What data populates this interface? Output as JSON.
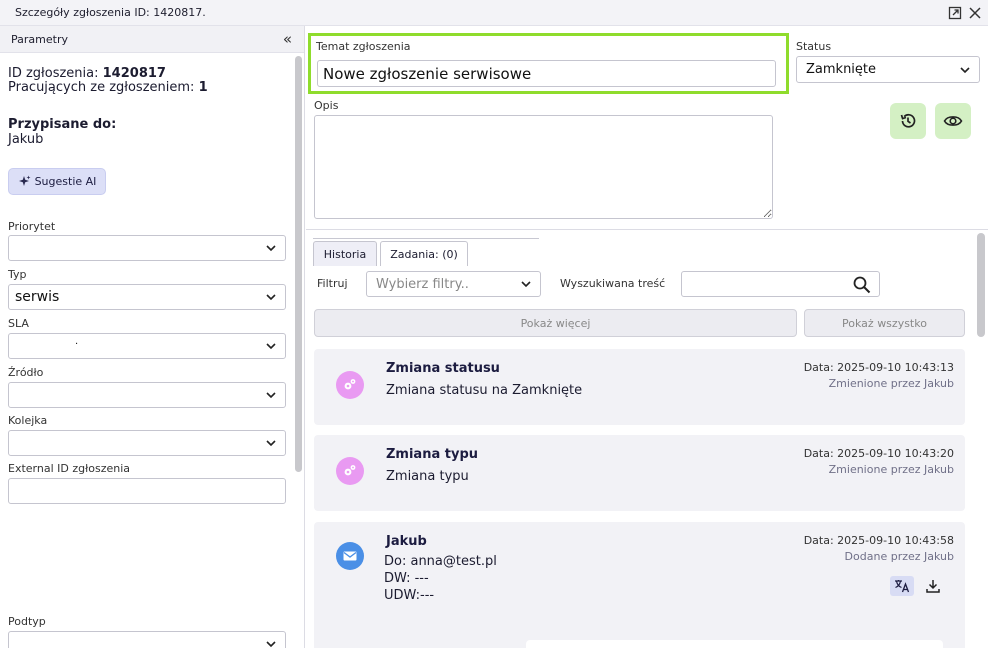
{
  "window": {
    "title": "Szczegóły zgłoszenia ID: 1420817."
  },
  "sidebar": {
    "header": "Parametry",
    "collapse_glyph": "«",
    "ticket_id_label": "ID zgłoszenia:",
    "ticket_id": "1420817",
    "working_label": "Pracujących ze zgłoszeniem:",
    "working_count": "1",
    "assigned_label": "Przypisane do:",
    "assigned_to": "Jakub",
    "ai_button": "Sugestie AI",
    "fields": {
      "priority": {
        "label": "Priorytet",
        "value": ""
      },
      "type": {
        "label": "Typ",
        "value": "serwis"
      },
      "sla": {
        "label": "SLA",
        "value": "."
      },
      "source": {
        "label": "Źródło",
        "value": ""
      },
      "queue": {
        "label": "Kolejka",
        "value": ""
      },
      "external_id": {
        "label": "External ID zgłoszenia",
        "value": ""
      },
      "subtype": {
        "label": "Podtyp",
        "value": ""
      }
    }
  },
  "main": {
    "subject_label": "Temat zgłoszenia",
    "subject_value": "Nowe zgłoszenie serwisowe",
    "status_label": "Status",
    "status_value": "Zamknięte",
    "description_label": "Opis",
    "tabs": [
      {
        "label": "Historia"
      },
      {
        "label": "Zadania: (0)"
      }
    ],
    "filter_label": "Filtruj",
    "filter_placeholder": "Wybierz filtry..",
    "search_label": "Wyszukiwana treść",
    "show_more": "Pokaż więcej",
    "show_all": "Pokaż wszystko",
    "history": [
      {
        "title": "Zmiana statusu",
        "body": "Zmiana statusu na Zamknięte",
        "date": "Data: 2025-09-10 10:43:13",
        "by": "Zmienione przez Jakub",
        "icon": "gears-icon"
      },
      {
        "title": "Zmiana typu",
        "body": "Zmiana typu",
        "date": "Data: 2025-09-10 10:43:20",
        "by": "Zmienione przez Jakub",
        "icon": "gears-icon"
      },
      {
        "title": "Jakub",
        "to": "Do: anna@test.pl",
        "cc": "DW: ---",
        "bcc": "UDW:---",
        "date": "Data: 2025-09-10 10:43:58",
        "by": "Dodane przez Jakub",
        "icon": "mail-icon"
      }
    ]
  },
  "colors": {
    "highlight": "#8fdc2c",
    "gear_icon_bg": "#e99af2",
    "mail_icon_bg": "#4a8fe6",
    "green_btn_bg": "#d4f0c4"
  }
}
